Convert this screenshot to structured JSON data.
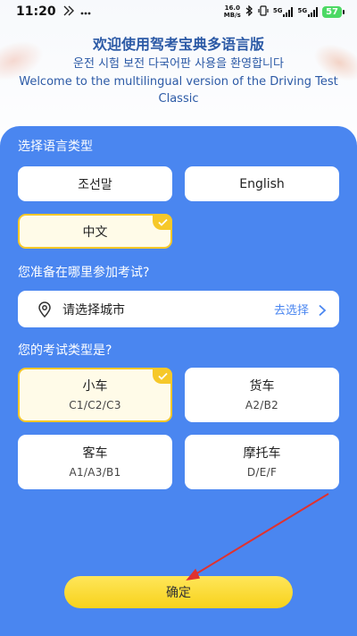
{
  "status_bar": {
    "time": "11:20",
    "net_speed_value": "16.0",
    "net_speed_unit": "MB/s",
    "sim1_label": "5G",
    "sim2_label": "5G",
    "battery": "57"
  },
  "header": {
    "title_cn": "欢迎使用驾考宝典多语言版",
    "title_kr": "운전 시험 보전 다국어판 사용을 환영합니다",
    "title_en": "Welcome to the multilingual version of the Driving Test Classic"
  },
  "language": {
    "section_title": "选择语言类型",
    "options": [
      "조선말",
      "English",
      "中文"
    ],
    "selected": "中文"
  },
  "city": {
    "section_title": "您准备在哪里参加考试?",
    "placeholder": "请选择城市",
    "action_label": "去选择"
  },
  "exam_type": {
    "section_title": "您的考试类型是?",
    "options": [
      {
        "name": "小车",
        "classes": "C1/C2/C3"
      },
      {
        "name": "货车",
        "classes": "A2/B2"
      },
      {
        "name": "客车",
        "classes": "A1/A3/B1"
      },
      {
        "name": "摩托车",
        "classes": "D/E/F"
      }
    ],
    "selected": "小车"
  },
  "confirm_label": "确定",
  "colors": {
    "panel_blue": "#4a86f0",
    "accent_yellow": "#f6c829",
    "annotation_red": "#e0322f"
  }
}
